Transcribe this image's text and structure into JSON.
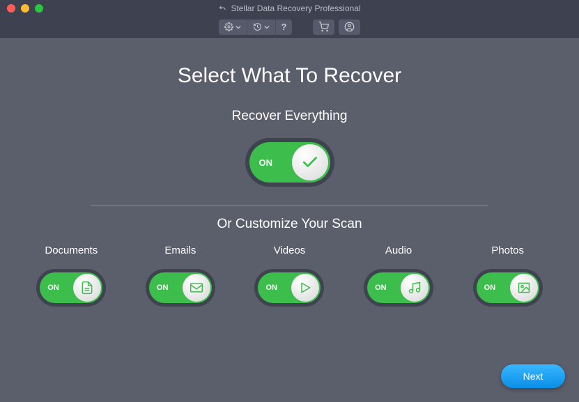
{
  "window": {
    "title": "Stellar Data Recovery Professional"
  },
  "heading": "Select What To Recover",
  "recover_all": {
    "label": "Recover Everything",
    "on_text": "ON",
    "state": "on"
  },
  "customize_label": "Or Customize Your Scan",
  "on_text": "ON",
  "categories": [
    {
      "label": "Documents",
      "icon": "document-icon",
      "state": "on"
    },
    {
      "label": "Emails",
      "icon": "mail-icon",
      "state": "on"
    },
    {
      "label": "Videos",
      "icon": "play-icon",
      "state": "on"
    },
    {
      "label": "Audio",
      "icon": "music-icon",
      "state": "on"
    },
    {
      "label": "Photos",
      "icon": "image-icon",
      "state": "on"
    }
  ],
  "next_label": "Next",
  "colors": {
    "accent_green": "#3cbd4c",
    "accent_blue": "#1ea0f1",
    "bg": "#5b5e6b"
  }
}
